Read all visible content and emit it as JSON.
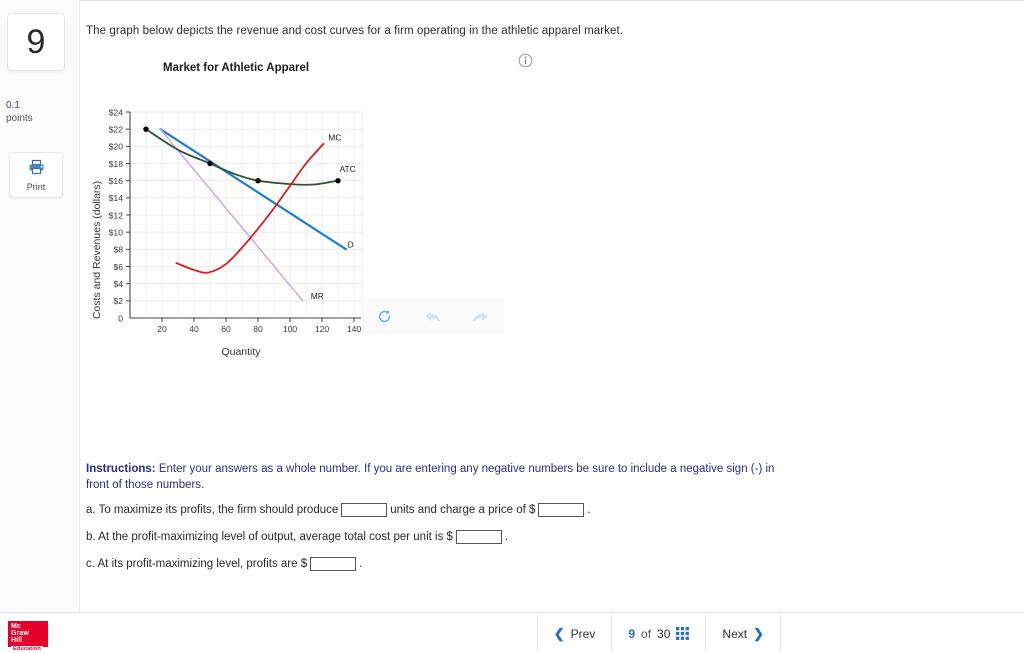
{
  "left_rail": {
    "question_number": "9",
    "points_value": "0.1",
    "points_label": "points",
    "print_label": "Print",
    "print_icon": "printer-icon"
  },
  "question": {
    "text": "The graph below depicts the revenue and cost curves for a firm operating in the athletic apparel market.",
    "info_icon": "info-circle-icon"
  },
  "graph_toolbar": {
    "reset_icon": "reset-circular-arrow-icon",
    "undo_icon": "undo-arrow-icon",
    "redo_icon": "redo-arrow-icon"
  },
  "instructions": {
    "label": "Instructions:",
    "text": " Enter your answers as a whole number. If you are entering any negative numbers be sure to include a negative sign (-) in front of those numbers."
  },
  "answers": {
    "a": {
      "prefix": "a. To maximize its profits, the firm should produce",
      "middle": "units and charge a price of $",
      "suffix": ".",
      "quantity_value": "",
      "price_value": ""
    },
    "b": {
      "prefix": "b. At the profit-maximizing level of output, average total cost per unit is $",
      "suffix": ".",
      "atc_value": ""
    },
    "c": {
      "prefix": "c. At its profit-maximizing level, profits are $",
      "suffix": ".",
      "profit_value": ""
    }
  },
  "footer": {
    "logo_line1": "Mc",
    "logo_line2": "Graw",
    "logo_line3": "Hill",
    "logo_line4": "Education",
    "prev_label": "Prev",
    "next_label": "Next",
    "current_page": "9",
    "of_label": "of",
    "total_pages": "30",
    "grid_icon": "grid-menu-icon",
    "prev_icon": "chevron-left-icon",
    "next_icon": "chevron-right-icon"
  },
  "chart_data": {
    "type": "line",
    "title": "Market for Athletic Apparel",
    "xlabel": "Quantity",
    "ylabel": "Costs and Revenues (dollars)",
    "xlim": [
      0,
      145
    ],
    "ylim": [
      0,
      24
    ],
    "xticks": [
      0,
      20,
      40,
      60,
      80,
      100,
      120,
      140
    ],
    "xtick_labels": [
      "0",
      "20",
      "40",
      "60",
      "80",
      "100",
      "120",
      "140"
    ],
    "yticks": [
      0,
      2,
      4,
      6,
      8,
      10,
      12,
      14,
      16,
      18,
      20,
      22,
      24
    ],
    "ytick_labels": [
      "0",
      "$2",
      "$4",
      "$6",
      "$8",
      "$10",
      "$12",
      "$14",
      "$16",
      "$18",
      "$20",
      "$22",
      "$24"
    ],
    "grid": true,
    "legend": "inline-labels",
    "series": [
      {
        "name": "D",
        "label": "D",
        "color": "#1a7fd4",
        "kind": "line",
        "label_pos": [
          136,
          8.2
        ],
        "points": [
          [
            19,
            22
          ],
          [
            135,
            8
          ]
        ]
      },
      {
        "name": "MR",
        "label": "MR",
        "color": "#c9a8e8",
        "kind": "line",
        "label_pos": [
          113,
          2.2
        ],
        "points": [
          [
            19,
            22
          ],
          [
            108,
            2
          ]
        ]
      },
      {
        "name": "ATC",
        "label": "ATC",
        "color": "#2f5233",
        "kind": "curve",
        "label_pos": [
          131,
          17.0
        ],
        "points": [
          [
            10,
            22
          ],
          [
            30,
            19.6
          ],
          [
            50,
            18
          ],
          [
            65,
            16.8
          ],
          [
            80,
            16
          ],
          [
            100,
            15.6
          ],
          [
            115,
            15.55
          ],
          [
            130,
            16
          ]
        ]
      },
      {
        "name": "MC",
        "label": "MC",
        "color": "#e01b1b",
        "kind": "curve",
        "label_pos": [
          124,
          20.7
        ],
        "points": [
          [
            29,
            6.4
          ],
          [
            40,
            5.6
          ],
          [
            49,
            5.3
          ],
          [
            60,
            6.3
          ],
          [
            70,
            8.2
          ],
          [
            80,
            10.4
          ],
          [
            90,
            12.8
          ],
          [
            100,
            15.4
          ],
          [
            110,
            18.0
          ],
          [
            121,
            20.3
          ]
        ]
      }
    ],
    "markers": [
      {
        "x": 10,
        "y": 22,
        "on": "ATC"
      },
      {
        "x": 50,
        "y": 18,
        "on": "ATC"
      },
      {
        "x": 80,
        "y": 16,
        "on": "ATC"
      },
      {
        "x": 130,
        "y": 16,
        "on": "ATC"
      }
    ]
  }
}
